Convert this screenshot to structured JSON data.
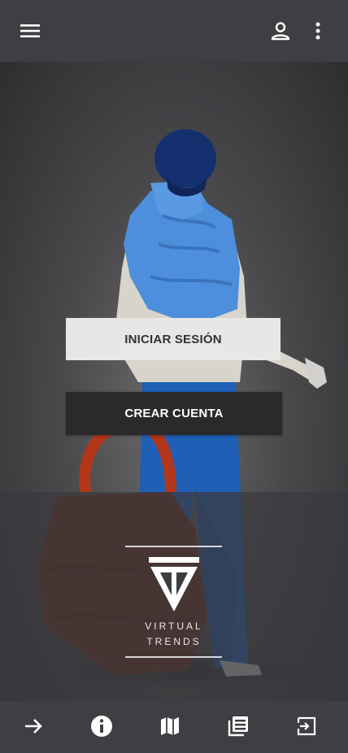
{
  "header": {
    "menu_icon": "menu-icon",
    "account_icon": "account-icon",
    "more_icon": "more-vert-icon"
  },
  "auth": {
    "login_label": "INICIAR SESIÓN",
    "register_label": "CREAR CUENTA"
  },
  "brand": {
    "line1": "VIRTUAL",
    "line2": "TRENDS"
  },
  "bottom_nav": {
    "items": [
      {
        "icon": "arrow-right-icon"
      },
      {
        "icon": "info-icon"
      },
      {
        "icon": "map-icon"
      },
      {
        "icon": "news-icon"
      },
      {
        "icon": "exit-icon"
      }
    ]
  },
  "colors": {
    "app_bar": "#3f3f43",
    "login_bg": "#e7e7e6",
    "register_bg": "#2a2a2c",
    "vest_blue": "#4d8fdc",
    "pants_blue": "#1f5fb5",
    "bag": "#6a2a1a"
  }
}
